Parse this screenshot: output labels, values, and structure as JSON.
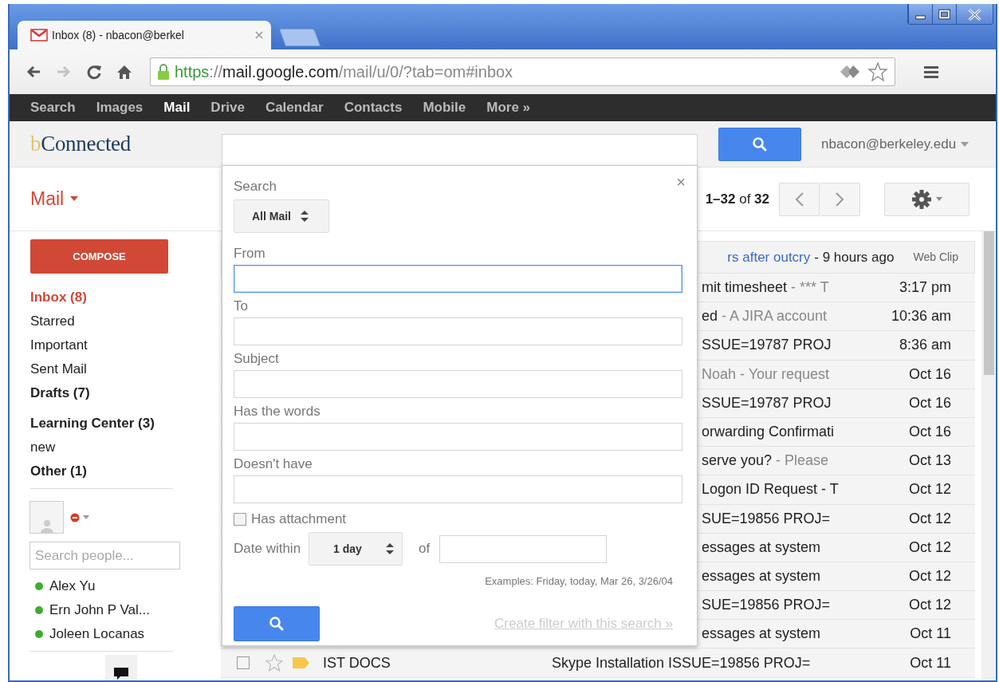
{
  "browser": {
    "tab": {
      "title": "Inbox (8) - nbacon@berkel"
    },
    "nav_buttons": [
      {
        "kind": "back",
        "disabled": false
      },
      {
        "kind": "forward",
        "disabled": true
      },
      {
        "kind": "reload",
        "disabled": false
      },
      {
        "kind": "home",
        "disabled": false
      }
    ],
    "address": {
      "secure": true,
      "parts": [
        {
          "kind": "scheme",
          "text": "https"
        },
        {
          "kind": "sep",
          "text": "://"
        },
        {
          "kind": "host",
          "text": "mail.google.com"
        },
        {
          "kind": "path",
          "text": "/mail/u/0/?tab=om#inbox"
        }
      ]
    }
  },
  "google_bar": [
    {
      "label": "Search",
      "selected": false
    },
    {
      "label": "Images",
      "selected": false
    },
    {
      "label": "Mail",
      "selected": true
    },
    {
      "label": "Drive",
      "selected": false
    },
    {
      "label": "Calendar",
      "selected": false
    },
    {
      "label": "Contacts",
      "selected": false
    },
    {
      "label": "Mobile",
      "selected": false
    },
    {
      "label": "More »",
      "selected": false
    }
  ],
  "header": {
    "logo": {
      "initial": "b",
      "rest": "Connected"
    },
    "account": "nbacon@berkeley.edu"
  },
  "mail_menu": "Mail",
  "pager": "**1–32** of **32**",
  "compose": "COMPOSE",
  "folders": [
    {
      "label": "Inbox (8)",
      "selected": true,
      "unread": true
    },
    {
      "label": "Starred",
      "selected": false,
      "unread": false
    },
    {
      "label": "Important",
      "selected": false,
      "unread": false
    },
    {
      "label": "Sent Mail",
      "selected": false,
      "unread": false
    },
    {
      "label": "Drafts (7)",
      "selected": false,
      "unread": true
    }
  ],
  "labels": [
    {
      "label": "Learning Center (3)",
      "unread": true
    },
    {
      "label": "new",
      "unread": false
    },
    {
      "label": "Other (1)",
      "unread": true
    }
  ],
  "chat": {
    "busy": true,
    "search_placeholder": "Search people...",
    "contacts": [
      {
        "name": "Alex Yu",
        "color": "#3cae2c"
      },
      {
        "name": "Ern John P Val...",
        "color": "#3cae2c"
      },
      {
        "name": "Joleen Locanas",
        "color": "#3cae2c"
      }
    ]
  },
  "web_clip": {
    "title": "rs after outcry",
    "age": "- 9 hours ago",
    "source": "Web Clip"
  },
  "messages": [
    {
      "kind": "partial",
      "subject": "mit timesheet",
      "preview": "- *** T",
      "date": "3:17 pm"
    },
    {
      "kind": "partial",
      "subject": "ed",
      "preview": "- A JIRA account",
      "date": "10:36 am"
    },
    {
      "kind": "partial",
      "subject": "SSUE=19787 PROJ",
      "date": "8:36 am"
    },
    {
      "kind": "partial",
      "preview": "Noah - Your request",
      "date": "Oct 16"
    },
    {
      "kind": "partial",
      "subject": "SSUE=19787 PROJ",
      "date": "Oct 16"
    },
    {
      "kind": "partial",
      "subject": "orwarding Confirmati",
      "date": "Oct 16"
    },
    {
      "kind": "partial",
      "subject": "serve you?",
      "preview": "- Please",
      "date": "Oct 13"
    },
    {
      "kind": "partial",
      "subject": "Logon ID Request - T",
      "date": "Oct 12"
    },
    {
      "kind": "partial",
      "subject": "SUE=19856 PROJ=",
      "date": "Oct 12"
    },
    {
      "kind": "partial",
      "subject": "essages at system",
      "date": "Oct 12"
    },
    {
      "kind": "partial",
      "subject": "essages at system",
      "date": "Oct 12"
    },
    {
      "kind": "partial",
      "subject": "SUE=19856 PROJ=",
      "date": "Oct 12"
    },
    {
      "kind": "partial",
      "subject": "essages at system",
      "date": "Oct 11"
    },
    {
      "kind": "full",
      "sender": "IST DOCS",
      "subject": "Skype Installation ISSUE=19856 PROJ=",
      "date": "Oct 11",
      "starred": false,
      "checked": false
    }
  ],
  "dialog": {
    "title": "Search",
    "close": "×",
    "scope": "All Mail",
    "fields": [
      {
        "label": "From",
        "focused": true
      },
      {
        "label": "To",
        "focused": false
      },
      {
        "label": "Subject",
        "focused": false
      },
      {
        "label": "Has the words",
        "focused": false
      },
      {
        "label": "Doesn't have",
        "focused": false
      }
    ],
    "has_attachment": {
      "label": "Has attachment",
      "checked": false
    },
    "date_within": {
      "label": "Date within",
      "value": "1 day",
      "of": "of"
    },
    "examples": "Examples: Friday, today, Mar 26, 3/26/04",
    "filter_link": "Create filter with this search »"
  }
}
